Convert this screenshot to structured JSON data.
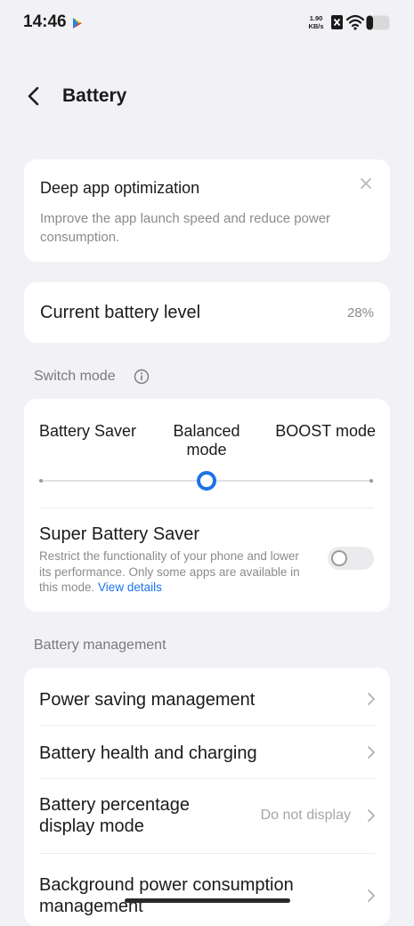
{
  "status_bar": {
    "time": "14:46",
    "net_speed_value": "1.90",
    "net_speed_unit": "KB/s",
    "icons": [
      "play-store-icon",
      "sim-icon",
      "wifi-icon",
      "battery-icon"
    ],
    "battery_fill_fraction": 0.28
  },
  "header": {
    "title": "Battery",
    "back_icon": "chevron-left-icon"
  },
  "optimization_card": {
    "title": "Deep app optimization",
    "description": "Improve the app launch speed and reduce power consumption.",
    "close_icon": "close-icon"
  },
  "battery_level": {
    "label": "Current battery level",
    "value": "28%"
  },
  "switch_mode": {
    "section_label": "Switch mode",
    "info_icon": "info-icon",
    "options": [
      "Battery Saver",
      "Balanced mode",
      "BOOST mode"
    ],
    "selected_index": 1,
    "super_saver": {
      "title": "Super Battery Saver",
      "description": "Restrict the functionality of your phone and lower its performance. Only some apps are available in this mode.",
      "link": "View details",
      "enabled": false
    }
  },
  "battery_management": {
    "section_label": "Battery management",
    "items": [
      {
        "label": "Power saving management",
        "value": ""
      },
      {
        "label": "Battery health and charging",
        "value": ""
      },
      {
        "label": "Battery percentage display mode",
        "value": "Do not display"
      },
      {
        "label": "Background power consumption management",
        "value": ""
      }
    ]
  },
  "colors": {
    "background": "#f2f2f6",
    "card": "#ffffff",
    "accent": "#1b73e8",
    "secondary_text": "#8b8b8e"
  }
}
